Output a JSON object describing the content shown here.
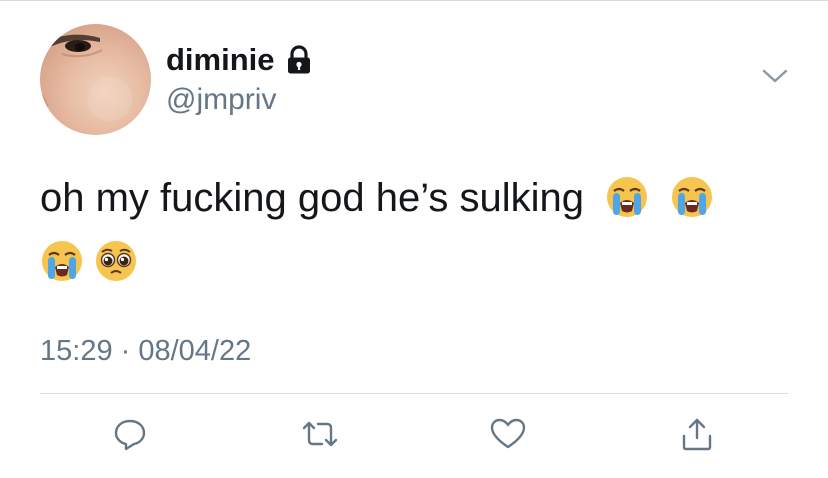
{
  "header": {
    "display_name": "diminie",
    "handle": "@jmpriv",
    "protected": true
  },
  "tweet": {
    "text": "oh my fucking god he’s sulking",
    "emojis_line1": [
      "loudly-crying-face",
      "loudly-crying-face"
    ],
    "emojis_line2": [
      "loudly-crying-face",
      "pleading-face"
    ],
    "timestamp": "15:29 · 08/04/22"
  },
  "actions": [
    "reply",
    "retweet",
    "like",
    "share"
  ],
  "colors": {
    "text": "#14171a",
    "secondary": "#657786",
    "divider": "#d9dde1"
  }
}
